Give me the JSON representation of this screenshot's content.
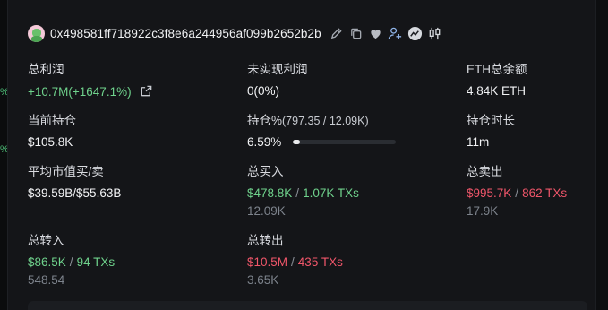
{
  "wallet": {
    "address": "0x498581ff718922c3f8e6a244956af099b2652b2b"
  },
  "edge_marks": [
    "%",
    "%"
  ],
  "stats": {
    "total_profit": {
      "label": "总利润",
      "value": "+10.7M(+1647.1%)"
    },
    "unrealized_profit": {
      "label": "未实现利润",
      "value": "0(0%)"
    },
    "eth_balance": {
      "label": "ETH总余额",
      "value": "4.84K ETH"
    },
    "current_position": {
      "label": "当前持仓",
      "value": "$105.8K"
    },
    "position_pct": {
      "label": "持仓%",
      "label_detail": "(797.35 / 12.09K)",
      "value": "6.59%",
      "progress": 0.0659
    },
    "hold_duration": {
      "label": "持仓时长",
      "value": "11m"
    },
    "avg_mcap": {
      "label": "平均市值买/卖",
      "value": "$39.59B/$55.63B"
    },
    "total_buy": {
      "label": "总买入",
      "amount": "$478.8K",
      "txs": "1.07K TXs",
      "qty": "12.09K"
    },
    "total_sell": {
      "label": "总卖出",
      "amount": "$995.7K",
      "txs": "862 TXs",
      "qty": "17.9K"
    },
    "transfer_in": {
      "label": "总转入",
      "amount": "$86.5K",
      "txs": "94 TXs",
      "qty": "548.54"
    },
    "transfer_out": {
      "label": "总转出",
      "amount": "$10.5M",
      "txs": "435 TXs",
      "qty": "3.65K"
    }
  },
  "separator": "/",
  "colors": {
    "positive": "#6fd28c",
    "negative": "#f0566a",
    "muted": "#7d838c",
    "background": "#141518"
  },
  "icons": [
    "edit-icon",
    "copy-icon",
    "heart-icon",
    "add-user-icon",
    "chart-logo-icon",
    "candlestick-icon",
    "external-link-icon"
  ]
}
